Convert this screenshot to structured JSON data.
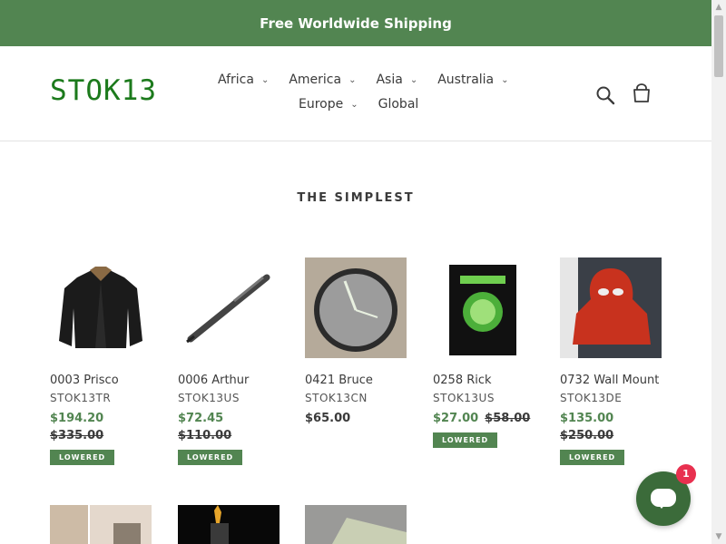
{
  "announcement": "Free Worldwide Shipping",
  "brand": {
    "logo": "STOK13"
  },
  "nav": {
    "row1": [
      "Africa",
      "America",
      "Asia",
      "Australia"
    ],
    "row2": [
      "Europe",
      "Global"
    ]
  },
  "section_title": "THE SIMPLEST",
  "products": [
    {
      "title": "0003 Prisco",
      "vendor": "STOK13TR",
      "price": "$194.20",
      "compare": "$335.00",
      "badge": "LOWERED"
    },
    {
      "title": "0006 Arthur",
      "vendor": "STOK13US",
      "price": "$72.45",
      "compare": "$110.00",
      "badge": "LOWERED"
    },
    {
      "title": "0421 Bruce",
      "vendor": "STOK13CN",
      "price": "$65.00"
    },
    {
      "title": "0258 Rick",
      "vendor": "STOK13US",
      "price": "$27.00",
      "compare": "$58.00",
      "badge": "LOWERED"
    },
    {
      "title": "0732 Wall Mount",
      "vendor": "STOK13DE",
      "price": "$135.00",
      "compare": "$250.00",
      "badge": "LOWERED"
    }
  ],
  "chat": {
    "unread_count": "1"
  },
  "colors": {
    "brand_green": "#528551",
    "logo_green": "#1c7a1c",
    "badge_red": "#e8304f"
  }
}
